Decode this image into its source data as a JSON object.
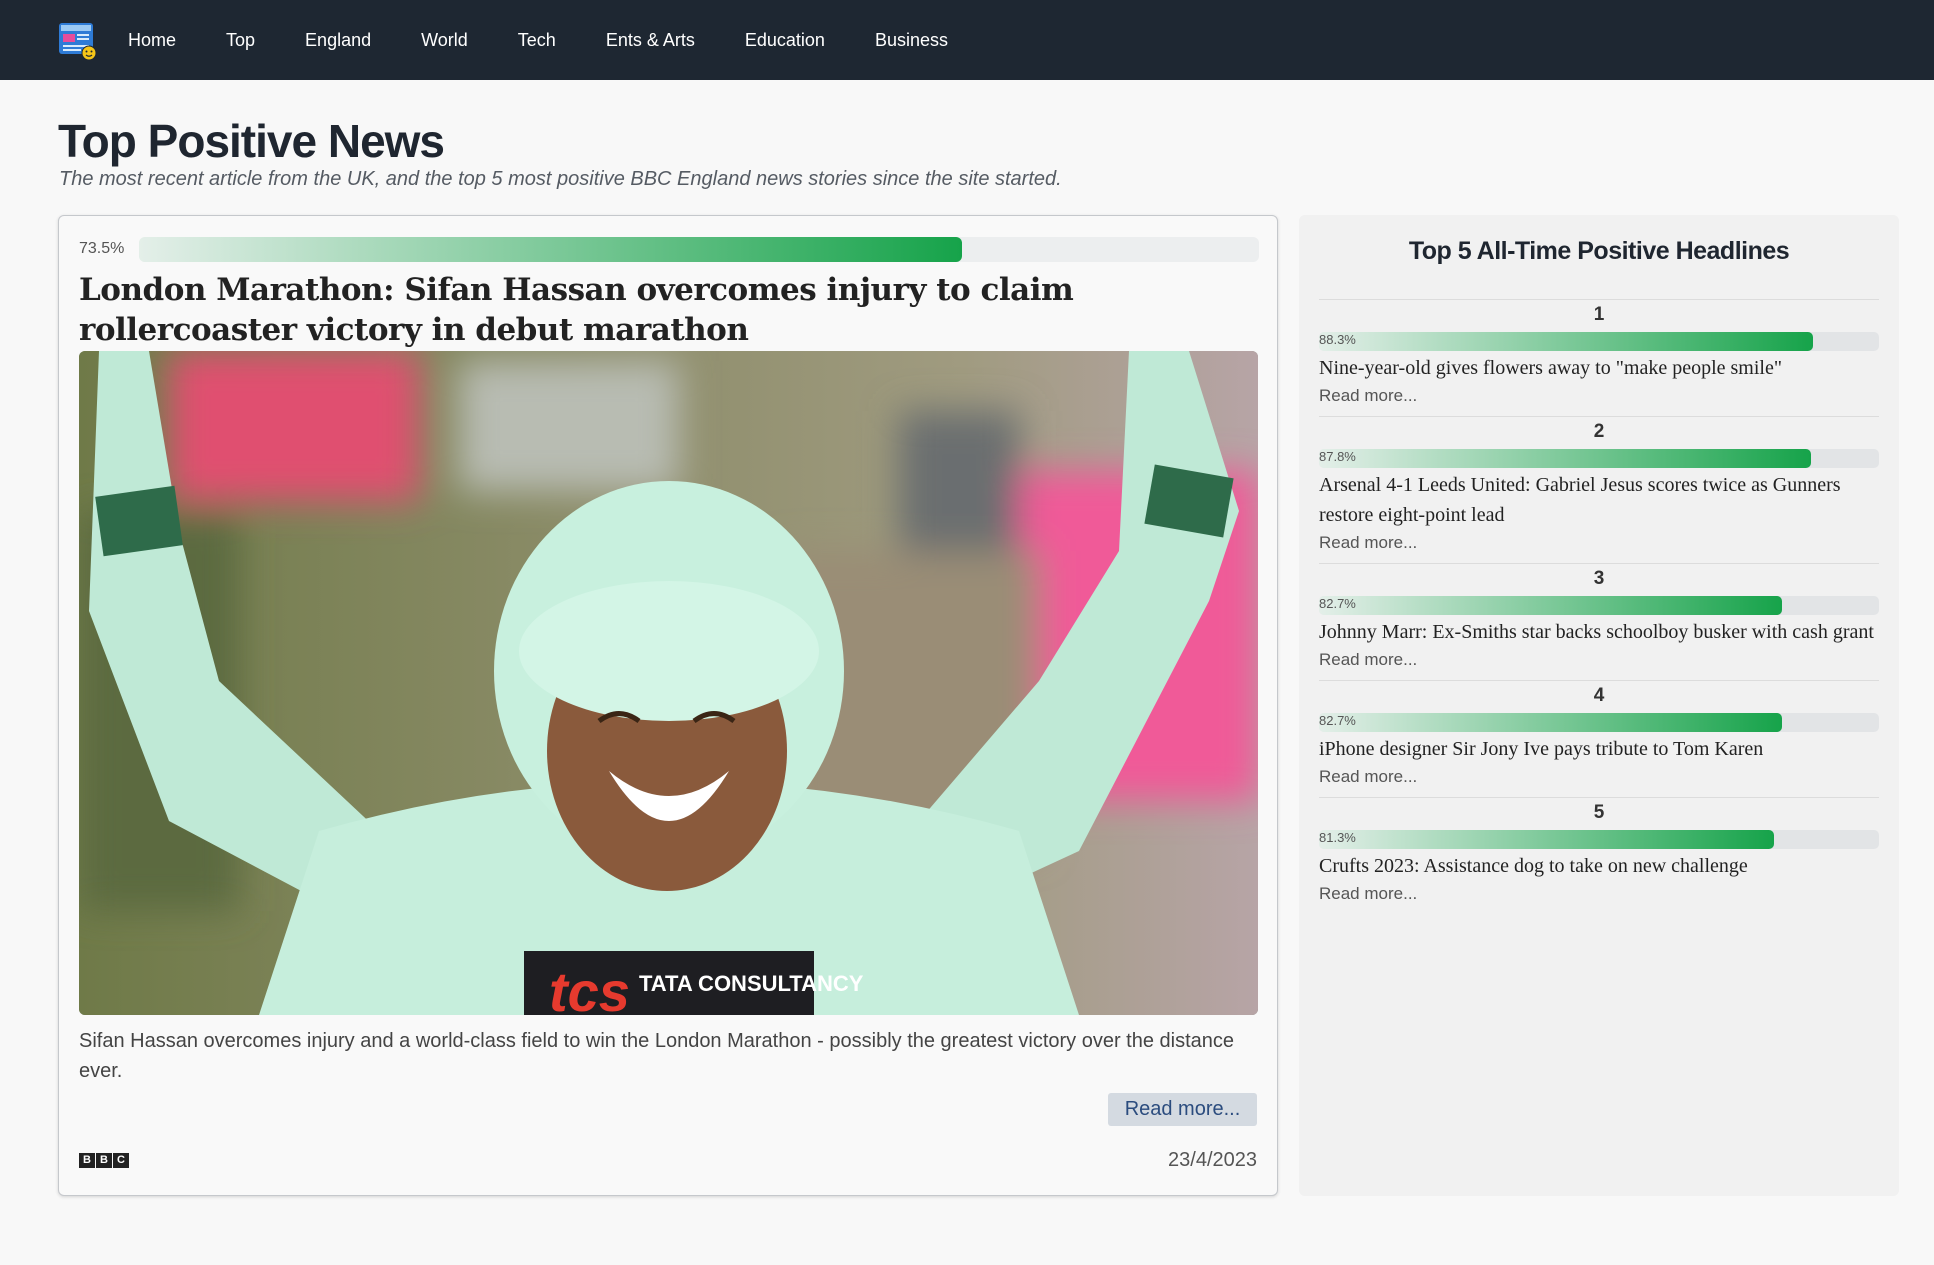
{
  "nav": {
    "logo_icon": "news-logo-icon",
    "links": [
      {
        "label": "Home"
      },
      {
        "label": "Top"
      },
      {
        "label": "England"
      },
      {
        "label": "World"
      },
      {
        "label": "Tech"
      },
      {
        "label": "Ents & Arts"
      },
      {
        "label": "Education"
      },
      {
        "label": "Business"
      }
    ]
  },
  "page": {
    "title": "Top Positive News",
    "subtitle": "The most recent article from the UK, and the top 5 most positive BBC England news stories since the site started."
  },
  "main_article": {
    "score_label": "73.5%",
    "score": 73.5,
    "headline": "London Marathon: Sifan Hassan overcomes injury to claim rollercoaster victory in debut marathon",
    "description": "Sifan Hassan overcomes injury and a world-class field to win the London Marathon - possibly the greatest victory over the distance ever.",
    "read_more": "Read more...",
    "date": "23/4/2023",
    "source_letters": [
      "B",
      "B",
      "C"
    ],
    "image_text": "TATA CONSULTANCY"
  },
  "side_panel": {
    "title": "Top 5 All-Time Positive Headlines",
    "items": [
      {
        "rank": "1",
        "score_label": "88.3%",
        "score": 88.3,
        "headline": "Nine-year-old gives flowers away to \"make people smile\"",
        "read_more": "Read more..."
      },
      {
        "rank": "2",
        "score_label": "87.8%",
        "score": 87.8,
        "headline": "Arsenal 4-1 Leeds United: Gabriel Jesus scores twice as Gunners restore eight-point lead",
        "read_more": "Read more..."
      },
      {
        "rank": "3",
        "score_label": "82.7%",
        "score": 82.7,
        "headline": "Johnny Marr: Ex-Smiths star backs schoolboy busker with cash grant",
        "read_more": "Read more..."
      },
      {
        "rank": "4",
        "score_label": "82.7%",
        "score": 82.7,
        "headline": "iPhone designer Sir Jony Ive pays tribute to Tom Karen",
        "read_more": "Read more..."
      },
      {
        "rank": "5",
        "score_label": "81.3%",
        "score": 81.3,
        "headline": "Crufts 2023: Assistance dog to take on new challenge",
        "read_more": "Read more..."
      }
    ]
  },
  "colors": {
    "navbar": "#1e2732",
    "bar_end": "#16a34a",
    "bar_start": "#e4efe9",
    "button_bg": "#d4dae1",
    "button_text": "#2b4c7e"
  }
}
